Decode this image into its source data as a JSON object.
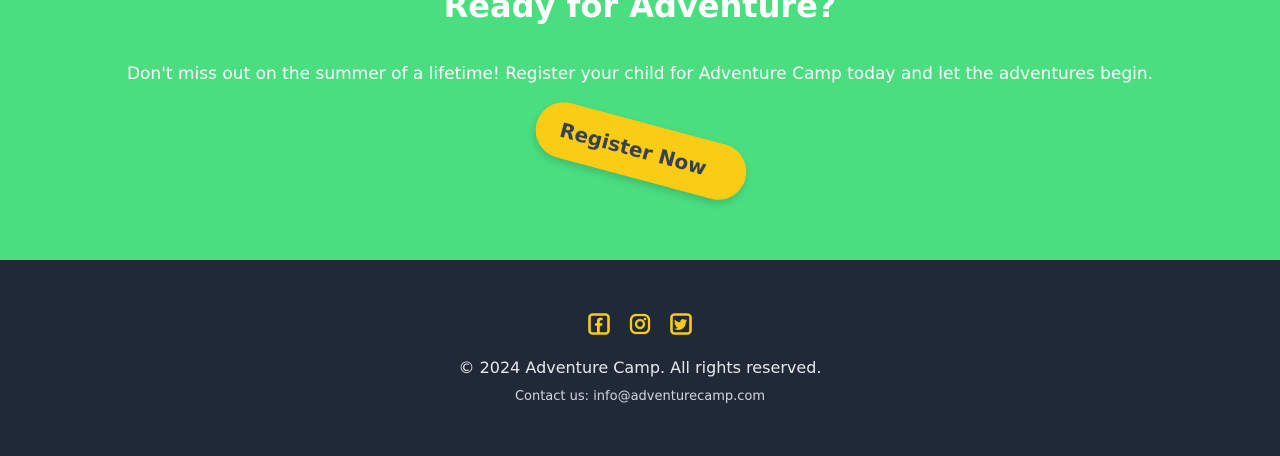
{
  "cta": {
    "title": "Ready for Adventure?",
    "text": "Don't miss out on the summer of a lifetime! Register your child for Adventure Camp today and let the adventures begin.",
    "button_label": "Register Now"
  },
  "footer": {
    "social": [
      {
        "name": "facebook",
        "icon": "facebook-square-icon"
      },
      {
        "name": "instagram",
        "icon": "instagram-icon"
      },
      {
        "name": "twitter",
        "icon": "twitter-square-icon"
      }
    ],
    "copyright": "© 2024 Adventure Camp. All rights reserved.",
    "contact_prefix": "Contact us: ",
    "contact_email": "info@adventurecamp.com"
  },
  "colors": {
    "cta_background": "#4ade80",
    "button": "#facc15",
    "footer_background": "#1f2937",
    "icon": "#facc15"
  }
}
